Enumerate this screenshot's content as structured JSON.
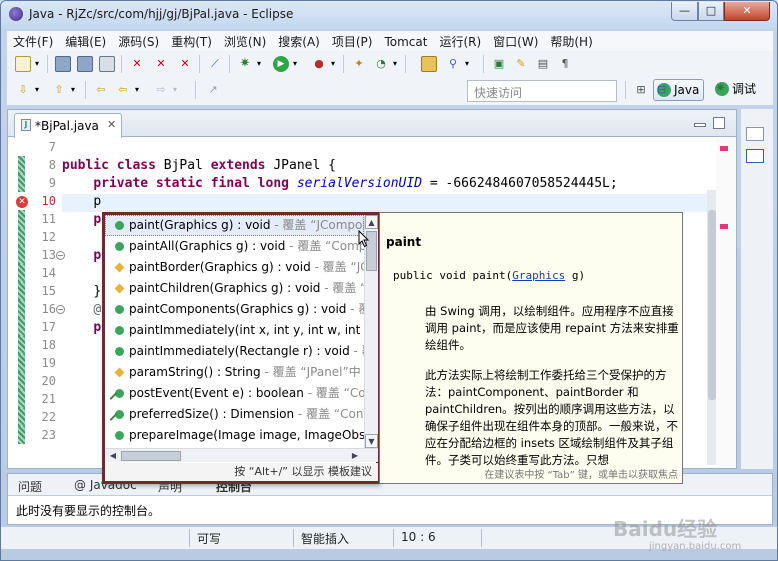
{
  "window": {
    "title": "Java - RjZc/src/com/hjj/gj/BjPal.java - Eclipse",
    "min": "—",
    "max": "□",
    "close": "✕"
  },
  "menu": [
    "文件(F)",
    "编辑(E)",
    "源码(S)",
    "重构(T)",
    "浏览(N)",
    "搜索(A)",
    "项目(P)",
    "Tomcat",
    "运行(R)",
    "窗口(W)",
    "帮助(H)"
  ],
  "toolbar": {
    "quick_access_placeholder": "快速访问",
    "perspective_java": "Java",
    "perspective_debug": "调试"
  },
  "editor": {
    "tab_label": "*BjPal.java",
    "tab_close": "✕",
    "line_numbers": [
      "7",
      "8",
      "9",
      "10",
      "11",
      "12",
      "13",
      "14",
      "15",
      "16",
      "17",
      "18",
      "19",
      "20",
      "21",
      "22",
      "23"
    ],
    "code": {
      "l8_kw1": "public class",
      "l8_name": " BjPal ",
      "l8_kw2": "extends",
      "l8_rest": " JPanel {",
      "l9_kw": "private static final long",
      "l9_field": "serialVersionUID",
      "l9_rest": " = -6662484607058524445L;",
      "l10": "p",
      "l11": "p",
      "l13": "p",
      "l15": "}",
      "l16": "@",
      "l17": "p"
    }
  },
  "assist": {
    "proposals": [
      {
        "sig": "paint(Graphics g) : void",
        "ov": " - 覆盖 “JComponent”",
        "icon": "public"
      },
      {
        "sig": "paintAll(Graphics g) : void",
        "ov": " - 覆盖 “Component”",
        "icon": "public"
      },
      {
        "sig": "paintBorder(Graphics g) : void",
        "ov": " - 覆盖 “JComponent”",
        "icon": "protected"
      },
      {
        "sig": "paintChildren(Graphics g) : void",
        "ov": " - 覆盖 “JComponent”",
        "icon": "protected"
      },
      {
        "sig": "paintComponents(Graphics g) : void",
        "ov": " - 覆盖 “Container”",
        "icon": "public"
      },
      {
        "sig": "paintImmediately(int x, int y, int w, int h)",
        "ov": "",
        "icon": "public"
      },
      {
        "sig": "paintImmediately(Rectangle r) : void",
        "ov": " - 覆盖",
        "icon": "public"
      },
      {
        "sig": "paramString() : String",
        "ov": " - 覆盖 “JPanel”中",
        "icon": "protected"
      },
      {
        "sig": "postEvent(Event e) : boolean",
        "ov": " - 覆盖 “Component”",
        "icon": "public-override"
      },
      {
        "sig": "preferredSize() : Dimension",
        "ov": " - 覆盖 “Container”",
        "icon": "public-override"
      },
      {
        "sig": "prepareImage(Image image, ImageObserver)",
        "ov": "",
        "icon": "public"
      }
    ],
    "footer": "按 “Alt+/” 以显示 模板建议"
  },
  "doc": {
    "title": "paint",
    "sig_pre": "public void paint(",
    "sig_link": "Graphics",
    "sig_post": " g)",
    "p1": "由 Swing 调用，以绘制组件。应用程序不应直接调用 paint，而是应该使用 repaint 方法来安排重绘组件。",
    "p2": "此方法实际上将绘制工作委托给三个受保护的方法：paintComponent、paintBorder 和 paintChildren。按列出的顺序调用这些方法，以确保子组件出现在组件本身的顶部。一般来说，不应在分配给边框的 insets 区域绘制组件及其子组件。子类可以始终重写此方法。只想",
    "footer": "在建议表中按 “Tab” 键，或单击以获取焦点"
  },
  "console": {
    "tabs": [
      "问题",
      "@ Javadoc",
      "声明",
      "控制台"
    ],
    "text": "此时没有要显示的控制台。"
  },
  "status": {
    "writable": "可写",
    "insert_mode": "智能插入",
    "position": "10 : 6"
  },
  "watermark": {
    "main": "Baidu经验",
    "sub": "jingyan.baidu.com"
  }
}
